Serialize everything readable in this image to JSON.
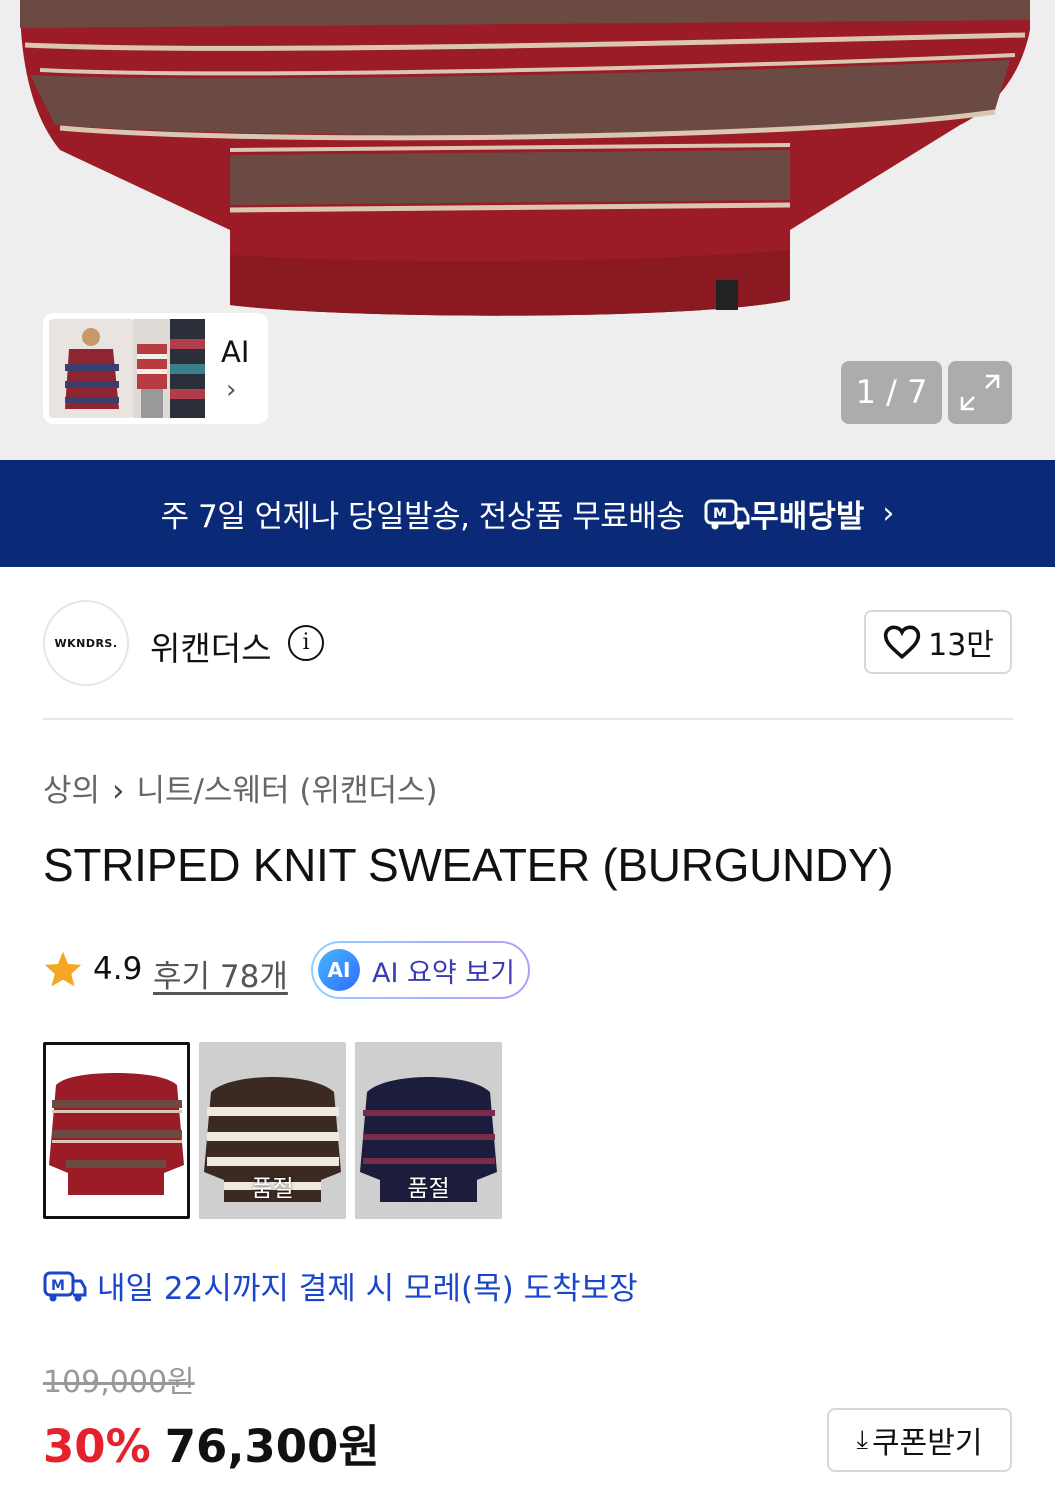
{
  "hero": {
    "thumb_label": "AI",
    "pager": "1 / 7"
  },
  "banner": {
    "text": "주 7일 언제나 당일발송, 전상품 무료배송",
    "logo_text": "무배당발"
  },
  "brand": {
    "logo_text": "WKNDRS.",
    "name": "위캔더스",
    "likes": "13만"
  },
  "breadcrumb": {
    "category": "상의",
    "subcategory": "니트/스웨터 (위캔더스)"
  },
  "product": {
    "title": "STRIPED KNIT SWEATER (BURGUNDY)",
    "rating": "4.9",
    "reviews": "후기 78개",
    "ai_badge": "AI",
    "ai_summary": "AI 요약 보기"
  },
  "variants": [
    {
      "name": "BURGUNDY",
      "sold_out": ""
    },
    {
      "name": "BROWN",
      "sold_out": "품절"
    },
    {
      "name": "NAVY",
      "sold_out": "품절"
    }
  ],
  "delivery": {
    "text": "내일 22시까지 결제 시 모레(목) 도착보장"
  },
  "price": {
    "original": "109,000원",
    "discount": "30%",
    "sale": "76,300원",
    "coupon": "쿠폰받기"
  },
  "colors": {
    "banner": "#0a2a78",
    "discount": "#e5222c",
    "delivery": "#1a46c9"
  }
}
